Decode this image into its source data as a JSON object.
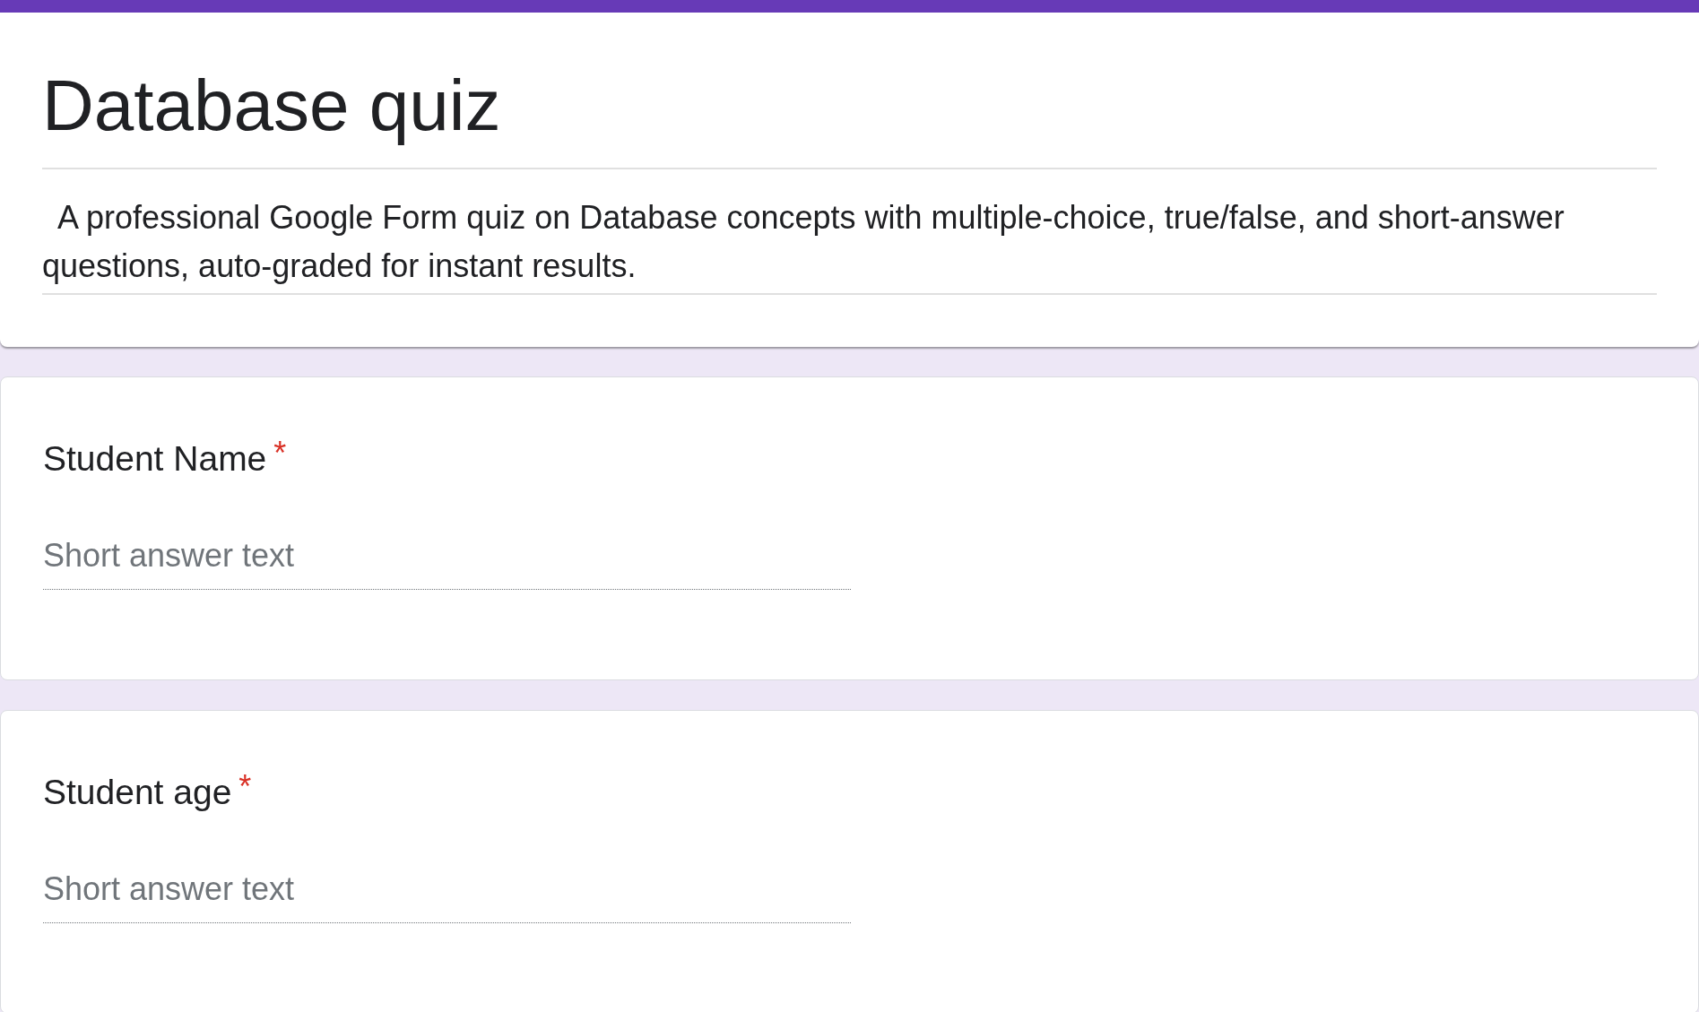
{
  "form": {
    "title": "Database quiz",
    "description": "A professional Google Form quiz on Database concepts with multiple-choice, true/false, and short-answer questions, auto-graded for instant results."
  },
  "questions": [
    {
      "title": "Student Name",
      "required_mark": "*",
      "placeholder": "Short answer text"
    },
    {
      "title": "Student age",
      "required_mark": "*",
      "placeholder": "Short answer text"
    }
  ]
}
